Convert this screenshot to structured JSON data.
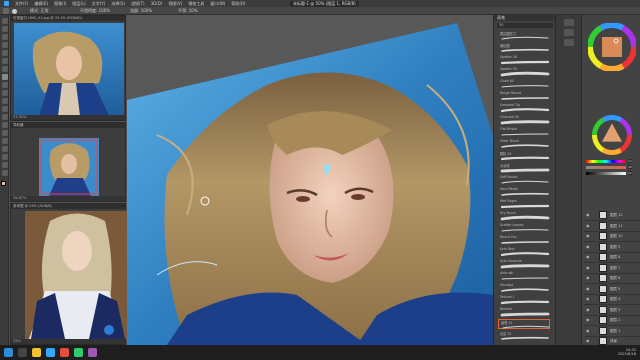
{
  "app": {
    "menus": [
      "文件(F)",
      "编辑(E)",
      "图像(I)",
      "图层(L)",
      "文字(Y)",
      "选择(S)",
      "滤镜(T)",
      "3D(D)",
      "视图(V)",
      "增效工具",
      "窗口(W)",
      "帮助(H)"
    ],
    "document_title": "未标题-1 @ 50% (图层 1, RGB/8)"
  },
  "options_bar": {
    "mode_label": "模式: 正常",
    "opacity_label": "不透明度: 100%",
    "flow_label": "流量: 100%",
    "smoothing_label": "平滑: 10%"
  },
  "navigators": [
    {
      "title": "可视窗口 (IMG_01.jpg @ 33.3% (RGB/8))",
      "footer": "33.33%"
    },
    {
      "title": "导航器",
      "footer": "16.67%"
    },
    {
      "title": "参考图 @ 25% (RGB/8)",
      "footer": "25%"
    }
  ],
  "brush_panel": {
    "header": "画笔",
    "size_label": "30",
    "brushes": [
      "柔边圆压力",
      "硬边圆",
      "Spatter 26",
      "Spatter 59",
      "Chalk 60",
      "Rough Round",
      "Sampled Tip",
      "Charcoal 90",
      "Flat Bristle",
      "Mixer Brush",
      "颗粒 40",
      "大涂抹",
      "Soft Round",
      "Hard Pastel",
      "Wet Edges",
      "Dry Brush",
      "Scatter Leaves",
      "Round Fan",
      "Kyle Real",
      "Kyle Gouache",
      "Airbrush",
      "Smudge",
      "Texture 1",
      "Blender",
      "画笔 21",
      "自定 22"
    ]
  },
  "color_panel": {
    "fg_color": "#f4b8a8",
    "bg_color": "#ffffff",
    "values": [
      "12",
      "48",
      "92",
      "255",
      "184",
      "168"
    ]
  },
  "layers": {
    "items": [
      "图层 12",
      "图层 11",
      "图层 10",
      "图层 9",
      "图层 8",
      "图层 7",
      "图层 6",
      "图层 5",
      "图层 4",
      "图层 3",
      "图层 2",
      "图层 1",
      "背景"
    ]
  },
  "taskbar": {
    "time": "14:32",
    "date": "2021/6/18"
  },
  "colors": {
    "canvas_sky": "#2f7fc0",
    "hair": "#b39766",
    "accent_orange": "#e06040"
  }
}
